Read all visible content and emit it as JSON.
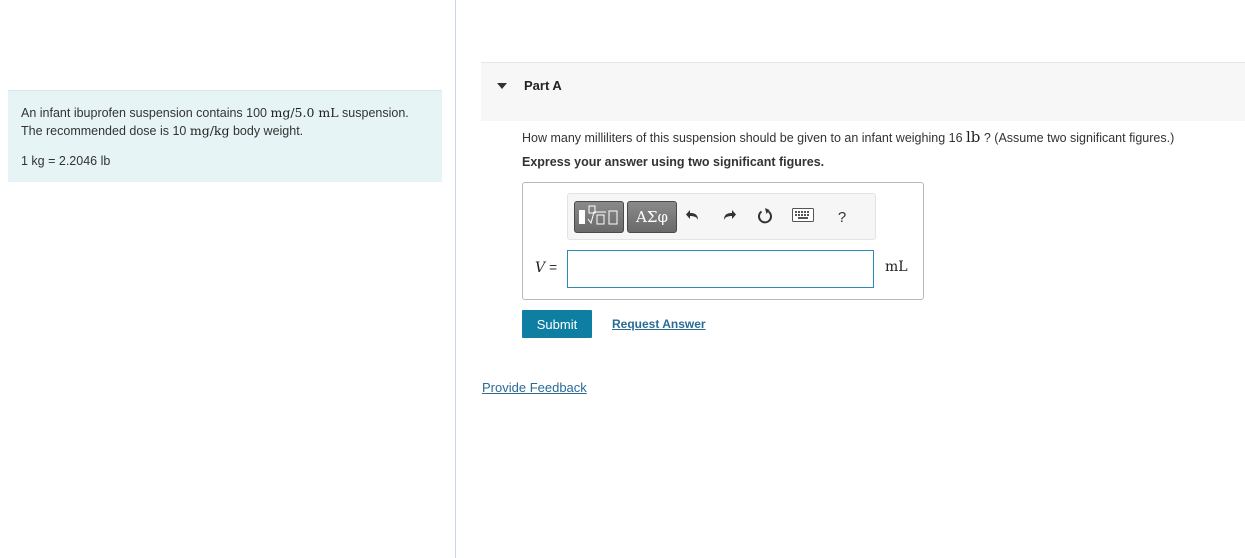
{
  "context": {
    "line1_pre": "An infant ibuprofen suspension contains 100 ",
    "line1_math": "mg/5.0 mL",
    "line1_post": " suspension.",
    "line2_pre": "The recommended dose is 10 ",
    "line2_math": "mg/kg",
    "line2_post": " body weight.",
    "conversion": "1 kg = 2.2046 lb"
  },
  "part": {
    "title": "Part A",
    "question_pre": "How many milliliters of this suspension should be given to an infant weighing 16 ",
    "question_math": "lb",
    "question_post": " ? (Assume two significant figures.)",
    "instruction": "Express your answer using two significant figures."
  },
  "toolbar": {
    "greek_label": "ΑΣφ",
    "help_label": "?",
    "icons": [
      "templates-icon",
      "greek-symbols-icon",
      "undo-icon",
      "redo-icon",
      "reset-icon",
      "keyboard-icon",
      "help-icon"
    ]
  },
  "answer": {
    "variable": "V",
    "equals": " =",
    "value": "",
    "unit": "mL"
  },
  "actions": {
    "submit_label": "Submit",
    "request_label": "Request Answer",
    "feedback_label": "Provide Feedback"
  },
  "colors": {
    "context_bg": "#e6f4f5",
    "submit_bg": "#0f7ea3",
    "link": "#2a6b96",
    "input_border": "#2d8bb0"
  }
}
